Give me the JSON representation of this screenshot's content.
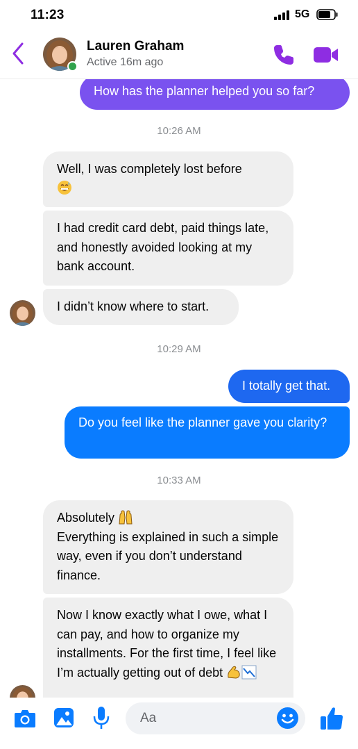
{
  "status_bar": {
    "time": "11:23",
    "network": "5G"
  },
  "header": {
    "contact_name": "Lauren Graham",
    "contact_status": "Active 16m ago",
    "accent_color": "#8e2de2"
  },
  "messages": {
    "top_outgoing": "How has the planner helped you so far?",
    "ts1": "10:26 AM",
    "in1": "Well, I was completely lost before",
    "in2": "I had credit card debt, paid things late, and honestly avoided looking at my bank account.",
    "in3": "I didn’t know where to start.",
    "ts2": "10:29 AM",
    "out1": "I totally get that.",
    "out2": "Do you feel like the planner gave you clarity?",
    "ts3": "10:33 AM",
    "in4_line1": "Absolutely",
    "in4_rest": "Everything is explained in such a simple way, even if you don’t understand finance.",
    "in5": "Now I know exactly what I owe, what I can pay, and how to organize my installments. For the first time, I feel like I’m actually getting out of debt"
  },
  "composer": {
    "placeholder": "Aa",
    "brand_color": "#0a7cff"
  }
}
